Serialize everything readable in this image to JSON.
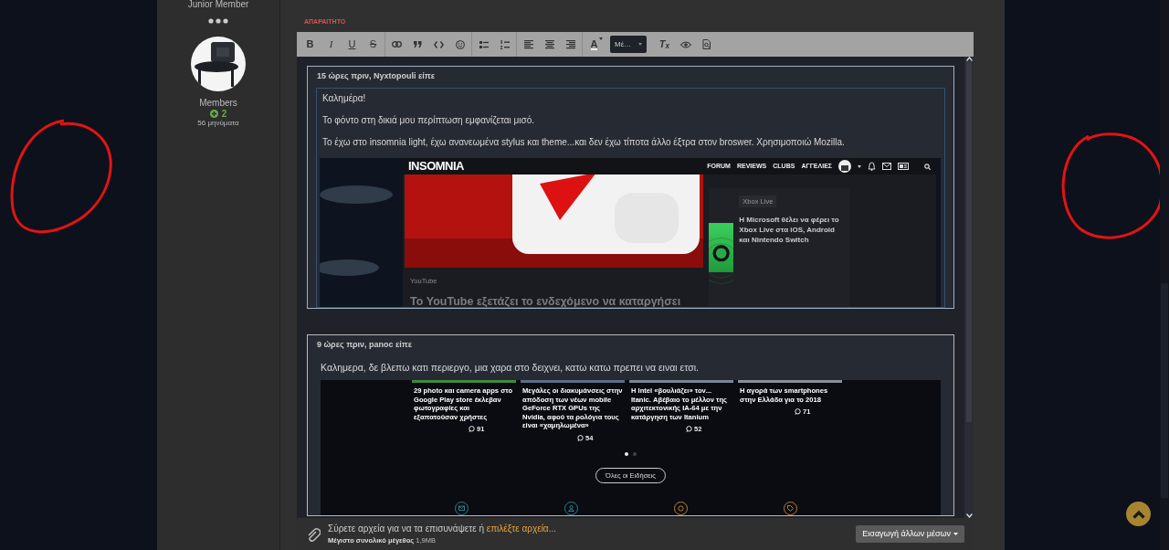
{
  "profile": {
    "rank": "Junior Member",
    "group": "Members",
    "reputation": "2",
    "posts": "56 μηνύματα"
  },
  "editor": {
    "required_label": "ΑΠΑΡΑΙΤΗΤΟ",
    "toolbar": {
      "format_buttons": [
        {
          "kind": "bold",
          "label": "B"
        },
        {
          "kind": "italic",
          "label": "I"
        },
        {
          "kind": "underline",
          "label": "U"
        },
        {
          "kind": "strike",
          "label": "S"
        }
      ],
      "color_button": "A",
      "font_dropdown": "Μέ…",
      "clear_button": "T$_{x}$"
    },
    "quotes": [
      {
        "header": "15 ώρες πριν, Nyxtopouli είπε",
        "paragraphs": [
          "Καλημέρα!",
          "Το φόντο στη δικιά μου περίπτωση εμφανίζεται μισό.",
          "Το έχω στο insomnia light, έχω ανανεωμένα stylus και theme...και δεν έχω τίποτα άλλο έξτρα στον broswer. Χρησιμοποιώ Mozilla."
        ],
        "screenshot": {
          "kind": "site_header",
          "logo": "INSOMNIA",
          "nav": [
            "FORUM",
            "REVIEWS",
            "CLUBS",
            "ΑΓΓΕΛΙΕΣ"
          ],
          "main_tag": "YouTube",
          "main_title": "Το YouTube εξετάζει το ενδεχόμενο να καταργήσει",
          "side_tag": "Xbox Live",
          "side_title": "Η Microsoft θέλει να φέρει το Xbox Live στα iOS, Android και Nintendo Switch"
        }
      },
      {
        "header": "9 ώρες πριν, panoc είπε",
        "paragraphs": [
          "Καλημερα, δε βλεπω κατι περιεργο, μια χαρα στο δειχνει, κατω κατω πρεπει να ειναι ετσι."
        ],
        "screenshot": {
          "kind": "news_list",
          "articles": [
            {
              "title": "29 photo και camera apps στο Google Play store έκλεβαν φωτογραφίες και εξαπατούσαν χρήστες",
              "comments": "91"
            },
            {
              "title": "Μεγάλες οι διακυμάνσεις στην απόδοση των νέων mobile GeForce RTX GPUs της Nvidia, αφού τα ρολόγια τους είναι «χαμηλωμένα»",
              "comments": "54"
            },
            {
              "title": "Η Intel «βουλιάζει» τον... Itanic. Αβέβαιο το μέλλον της αρχιτεκτονικής IA-64 με την κατάργηση των Itanium",
              "comments": "52"
            },
            {
              "title": "Η αγορά των smartphones στην Ελλάδα για το 2018",
              "comments": "71"
            }
          ],
          "dots": [
            {
              "selected": true
            },
            {
              "selected": false
            }
          ],
          "button": "Όλες οι Ειδήσεις"
        }
      }
    ],
    "attachments": {
      "hint": "Σύρετε αρχεία για να τα επισυνάψετε ή ",
      "link": "επιλέξτε αρχεία...",
      "limit": "**Μέγιστο συνολικό μέγεθος** 1,9MB",
      "button": "Εισαγωγή άλλων μέσων"
    }
  }
}
